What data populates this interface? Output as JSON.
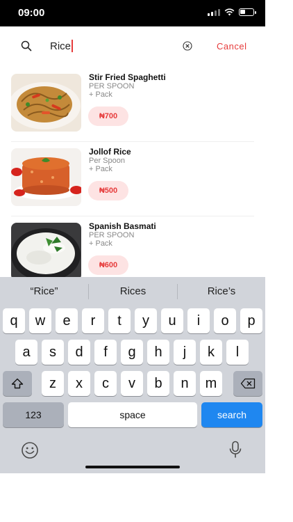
{
  "status": {
    "time": "09:00",
    "battery_level": 0.4
  },
  "search": {
    "query": "Rice",
    "cancel_label": "Cancel"
  },
  "results": [
    {
      "name": "Stir Fried Spaghetti",
      "unit": "PER SPOON",
      "pack": "+ Pack",
      "price": "₦700"
    },
    {
      "name": "Jollof Rice",
      "unit": "Per Spoon",
      "pack": "+ Pack",
      "price": "₦500"
    },
    {
      "name": "Spanish Basmati",
      "unit": "PER SPOON",
      "pack": "+ Pack",
      "price": "₦600"
    }
  ],
  "keyboard": {
    "suggestions": [
      "“Rice”",
      "Rices",
      "Rice’s"
    ],
    "row1": [
      "q",
      "w",
      "e",
      "r",
      "t",
      "y",
      "u",
      "i",
      "o",
      "p"
    ],
    "row2": [
      "a",
      "s",
      "d",
      "f",
      "g",
      "h",
      "j",
      "k",
      "l"
    ],
    "row3": [
      "z",
      "x",
      "c",
      "v",
      "b",
      "n",
      "m"
    ],
    "numbers_label": "123",
    "space_label": "space",
    "search_label": "search"
  },
  "colors": {
    "accent": "#e63b3b",
    "price_bg": "#fde3e3",
    "keyboard_bg": "#d1d4da",
    "search_key": "#1f87f0"
  }
}
